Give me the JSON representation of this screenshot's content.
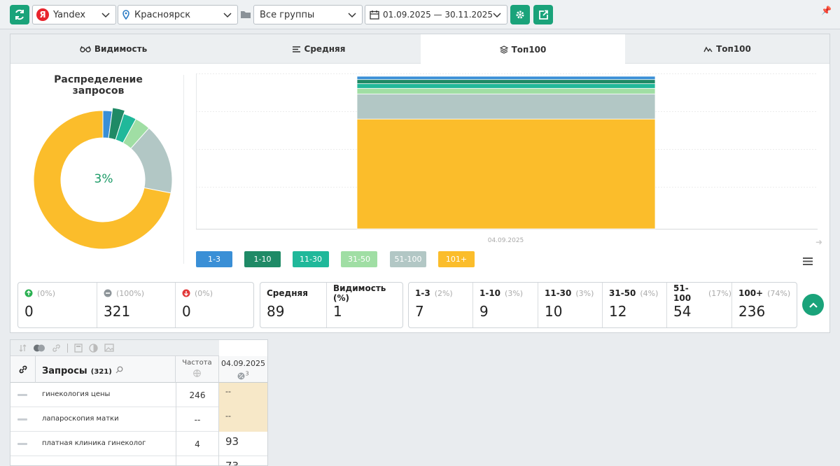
{
  "topbar": {
    "search_engine": "Yandex",
    "region": "Красноярск",
    "group": "Все группы",
    "date_range": "01.09.2025 — 30.11.2025"
  },
  "tabs": [
    {
      "label": "Видимость",
      "icon": "glasses-icon",
      "active": false
    },
    {
      "label": "Средняя",
      "icon": "lines-icon",
      "active": false
    },
    {
      "label": "Топ100",
      "icon": "layers-icon",
      "active": true
    },
    {
      "label": "Топ100",
      "icon": "trend-icon",
      "active": false
    }
  ],
  "distribution": {
    "title": "Распределение запросов",
    "center_value": "3%"
  },
  "chart_data": {
    "type": "bar",
    "stacked": true,
    "x": [
      "04.09.2025"
    ],
    "series": [
      {
        "name": "1-3",
        "values": [
          7
        ],
        "color": "#3a8fd6"
      },
      {
        "name": "1-10",
        "values": [
          9
        ],
        "color": "#1f8a66"
      },
      {
        "name": "11-30",
        "values": [
          10
        ],
        "color": "#20b89a"
      },
      {
        "name": "31-50",
        "values": [
          12
        ],
        "color": "#a0dea4"
      },
      {
        "name": "51-100",
        "values": [
          54
        ],
        "color": "#b2c7c5"
      },
      {
        "name": "101+",
        "values": [
          236
        ],
        "color": "#fbbd2b"
      }
    ],
    "grid": true,
    "legend_position": "bottom"
  },
  "stats": {
    "changes": [
      {
        "icon": "arrow-up-circle-icon",
        "pct": "(0%)",
        "value": "0",
        "color": "#2ab051"
      },
      {
        "icon": "minus-circle-icon",
        "pct": "(100%)",
        "value": "321",
        "color": "#8d9499"
      },
      {
        "icon": "arrow-down-circle-icon",
        "pct": "(0%)",
        "value": "0",
        "color": "#e23a3a"
      }
    ],
    "avg": [
      {
        "label": "Средняя",
        "value": "89"
      },
      {
        "label": "Видимость (%)",
        "value": "1"
      }
    ],
    "ranges": [
      {
        "label": "1-3",
        "pct": "(2%)",
        "value": "7"
      },
      {
        "label": "1-10",
        "pct": "(3%)",
        "value": "9"
      },
      {
        "label": "11-30",
        "pct": "(3%)",
        "value": "10"
      },
      {
        "label": "31-50",
        "pct": "(4%)",
        "value": "12"
      },
      {
        "label": "51-100",
        "pct": "(17%)",
        "value": "54"
      },
      {
        "label": "100+",
        "pct": "(74%)",
        "value": "236"
      }
    ]
  },
  "table": {
    "queries_label": "Запросы",
    "queries_count": "(321)",
    "freq_label": "Частота",
    "date_col": "04.09.2025",
    "date_sup": "3",
    "rows": [
      {
        "query": "гинекология цены",
        "freq": "246",
        "pos": "--",
        "highlight": true
      },
      {
        "query": "лапароскопия матки",
        "freq": "--",
        "pos": "--",
        "highlight": true
      },
      {
        "query": "платная клиника гинеколог",
        "freq": "4",
        "pos": "93",
        "highlight": false
      },
      {
        "query": "",
        "freq": "",
        "pos": "73",
        "highlight": false
      }
    ]
  },
  "colors": {
    "accent": "#1aa37a"
  }
}
